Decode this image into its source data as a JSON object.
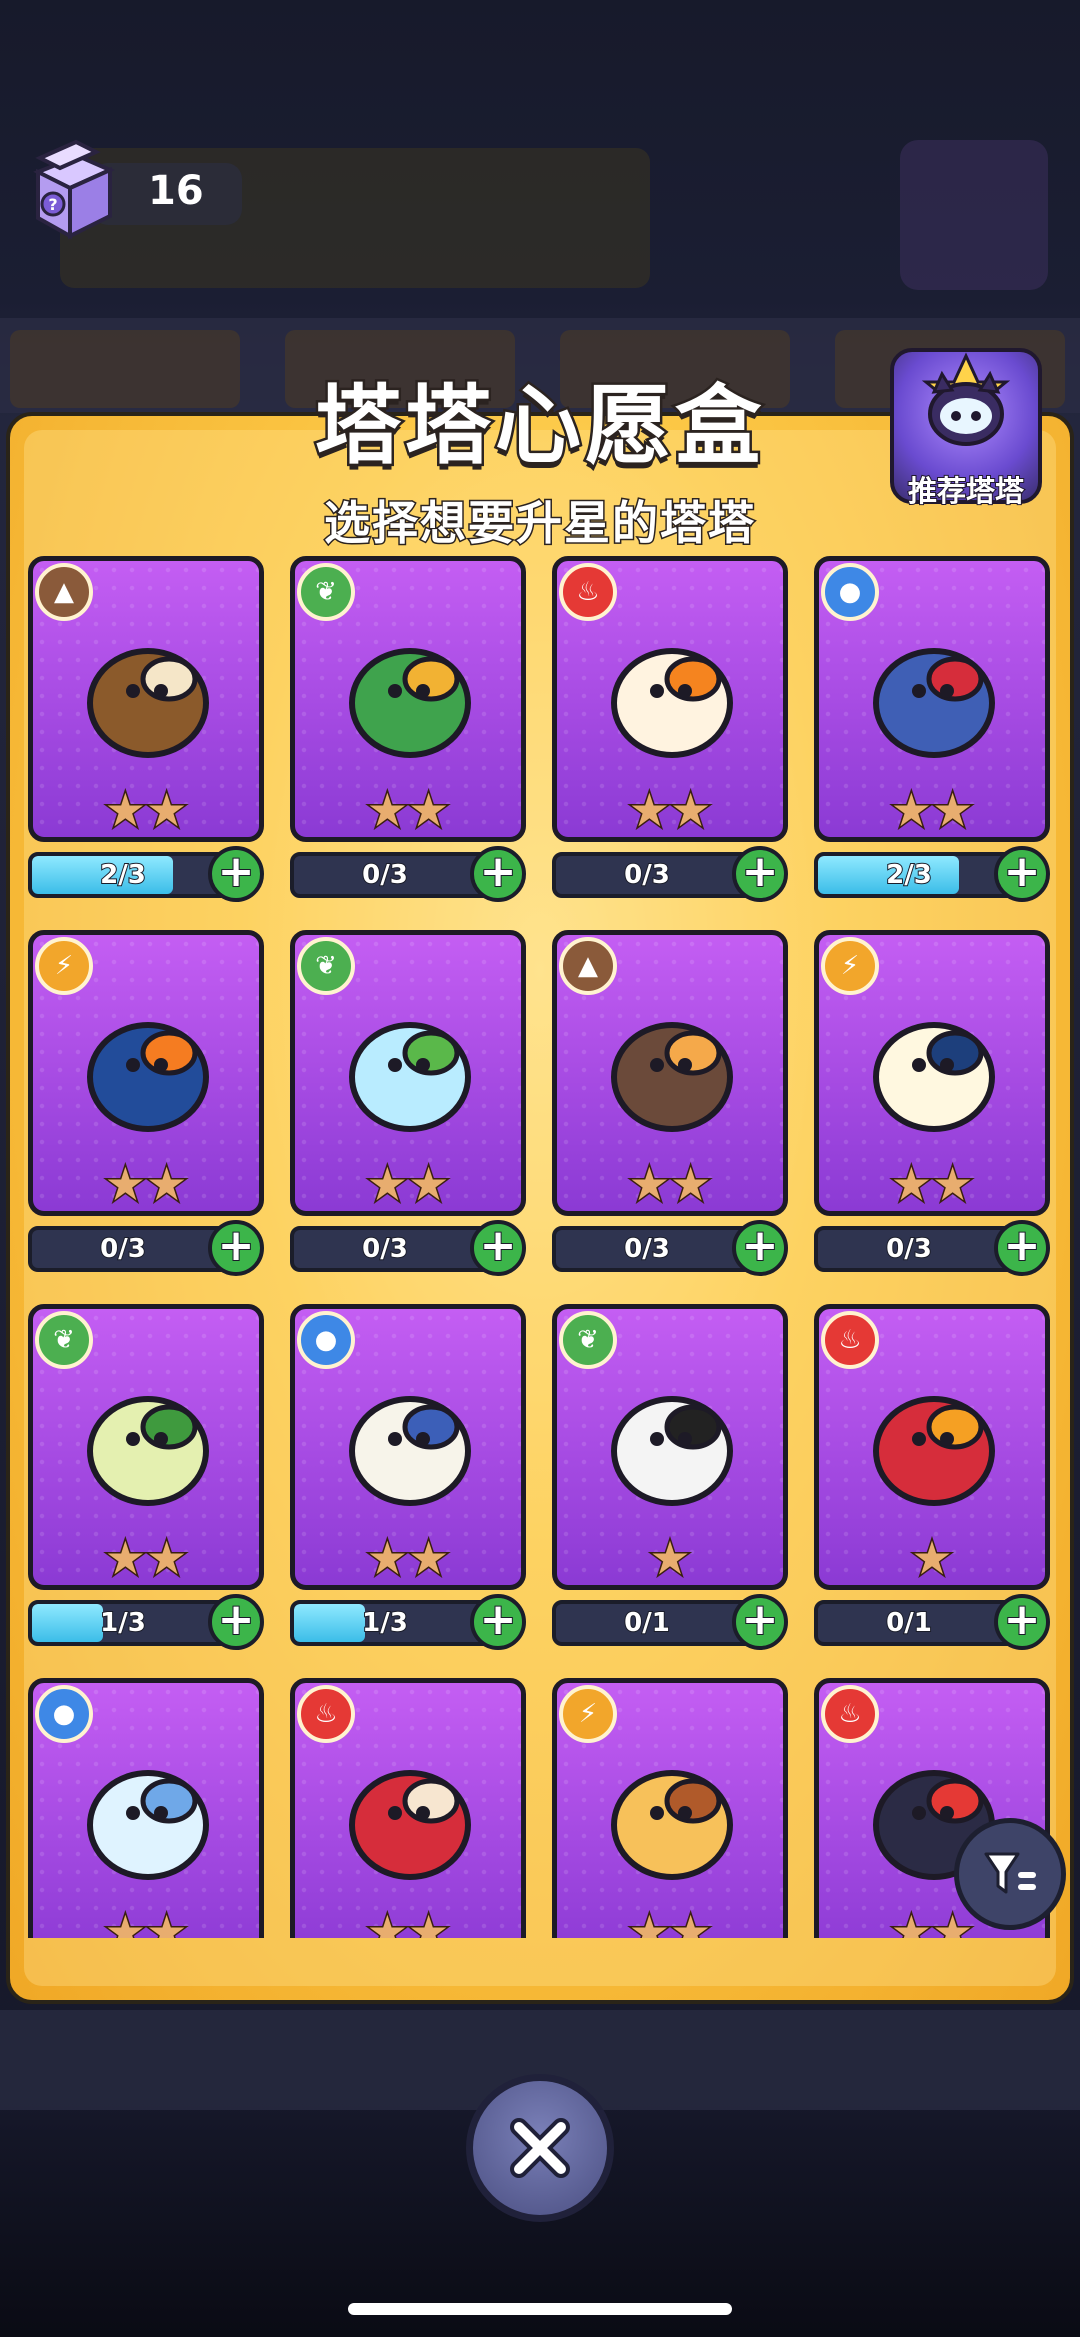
{
  "header": {
    "counter_value": "16",
    "title": "塔塔心愿盒",
    "subtitle": "选择想要升星的塔塔",
    "recommend_label": "推荐塔塔"
  },
  "colors": {
    "panel_gold": "#fcc846",
    "card_purple": "#a54be0",
    "progress_blue": "#3bbde8",
    "add_green": "#3cb54a",
    "element_earth": "#8a5a3a",
    "element_grass": "#4caf50",
    "element_fire": "#e53935",
    "element_water": "#3e88e6",
    "element_thunder": "#f2a62b"
  },
  "cards": [
    {
      "element": "earth",
      "creature": "turtle-icon",
      "stars": "★★",
      "progress": "2/3",
      "fill": 0.667,
      "body": "#8b5a2b",
      "accent": "#f5e6c8"
    },
    {
      "element": "grass",
      "creature": "toucan-leaf-icon",
      "stars": "★★",
      "progress": "0/3",
      "fill": 0,
      "body": "#3fa34d",
      "accent": "#f2b233"
    },
    {
      "element": "fire",
      "creature": "chicken-icon",
      "stars": "★★",
      "progress": "0/3",
      "fill": 0,
      "body": "#fff3e0",
      "accent": "#f5841f"
    },
    {
      "element": "water",
      "creature": "crab-icon",
      "stars": "★★",
      "progress": "2/3",
      "fill": 0.667,
      "body": "#3f5fb5",
      "accent": "#d62d3b"
    },
    {
      "element": "thunder",
      "creature": "toucan-icon",
      "stars": "★★",
      "progress": "0/3",
      "fill": 0,
      "body": "#224c9a",
      "accent": "#f57c21"
    },
    {
      "element": "grass",
      "creature": "jar-frog-icon",
      "stars": "★★",
      "progress": "0/3",
      "fill": 0,
      "body": "#b9ecff",
      "accent": "#5ab84a"
    },
    {
      "element": "earth",
      "creature": "hermit-crab-icon",
      "stars": "★★",
      "progress": "0/3",
      "fill": 0,
      "body": "#6b4a3a",
      "accent": "#f5a94a"
    },
    {
      "element": "thunder",
      "creature": "cloud-bird-icon",
      "stars": "★★",
      "progress": "0/3",
      "fill": 0,
      "body": "#fff8e0",
      "accent": "#1d3f7c"
    },
    {
      "element": "grass",
      "creature": "leaf-duck-icon",
      "stars": "★★",
      "progress": "1/3",
      "fill": 0.333,
      "body": "#e4f0b0",
      "accent": "#3f9a3e"
    },
    {
      "element": "water",
      "creature": "polar-bear-icon",
      "stars": "★★",
      "progress": "1/3",
      "fill": 0.333,
      "body": "#f7f4ea",
      "accent": "#3c5fb8"
    },
    {
      "element": "grass",
      "creature": "panda-icon",
      "stars": "★",
      "progress": "0/1",
      "fill": 0,
      "body": "#f4f4f4",
      "accent": "#222222"
    },
    {
      "element": "fire",
      "creature": "boxer-owl-icon",
      "stars": "★",
      "progress": "0/1",
      "fill": 0,
      "body": "#d62d3b",
      "accent": "#f5a023"
    },
    {
      "element": "water",
      "creature": "jellyfish-icon",
      "stars": "★★",
      "progress": "",
      "fill": 0,
      "body": "#dff3ff",
      "accent": "#6fa8e8"
    },
    {
      "element": "fire",
      "creature": "ladybug-icon",
      "stars": "★★",
      "progress": "",
      "fill": 0,
      "body": "#d62d3b",
      "accent": "#f7e6d0"
    },
    {
      "element": "thunder",
      "creature": "lucky-cat-icon",
      "stars": "★★",
      "progress": "",
      "fill": 0,
      "body": "#f7c15a",
      "accent": "#b05a2a"
    },
    {
      "element": "fire",
      "creature": "black-cat-icon",
      "stars": "★★",
      "progress": "",
      "fill": 0,
      "body": "#2b2b45",
      "accent": "#e53935"
    }
  ],
  "controls": {
    "filter_icon": "filter-icon",
    "close_icon": "close-icon"
  }
}
